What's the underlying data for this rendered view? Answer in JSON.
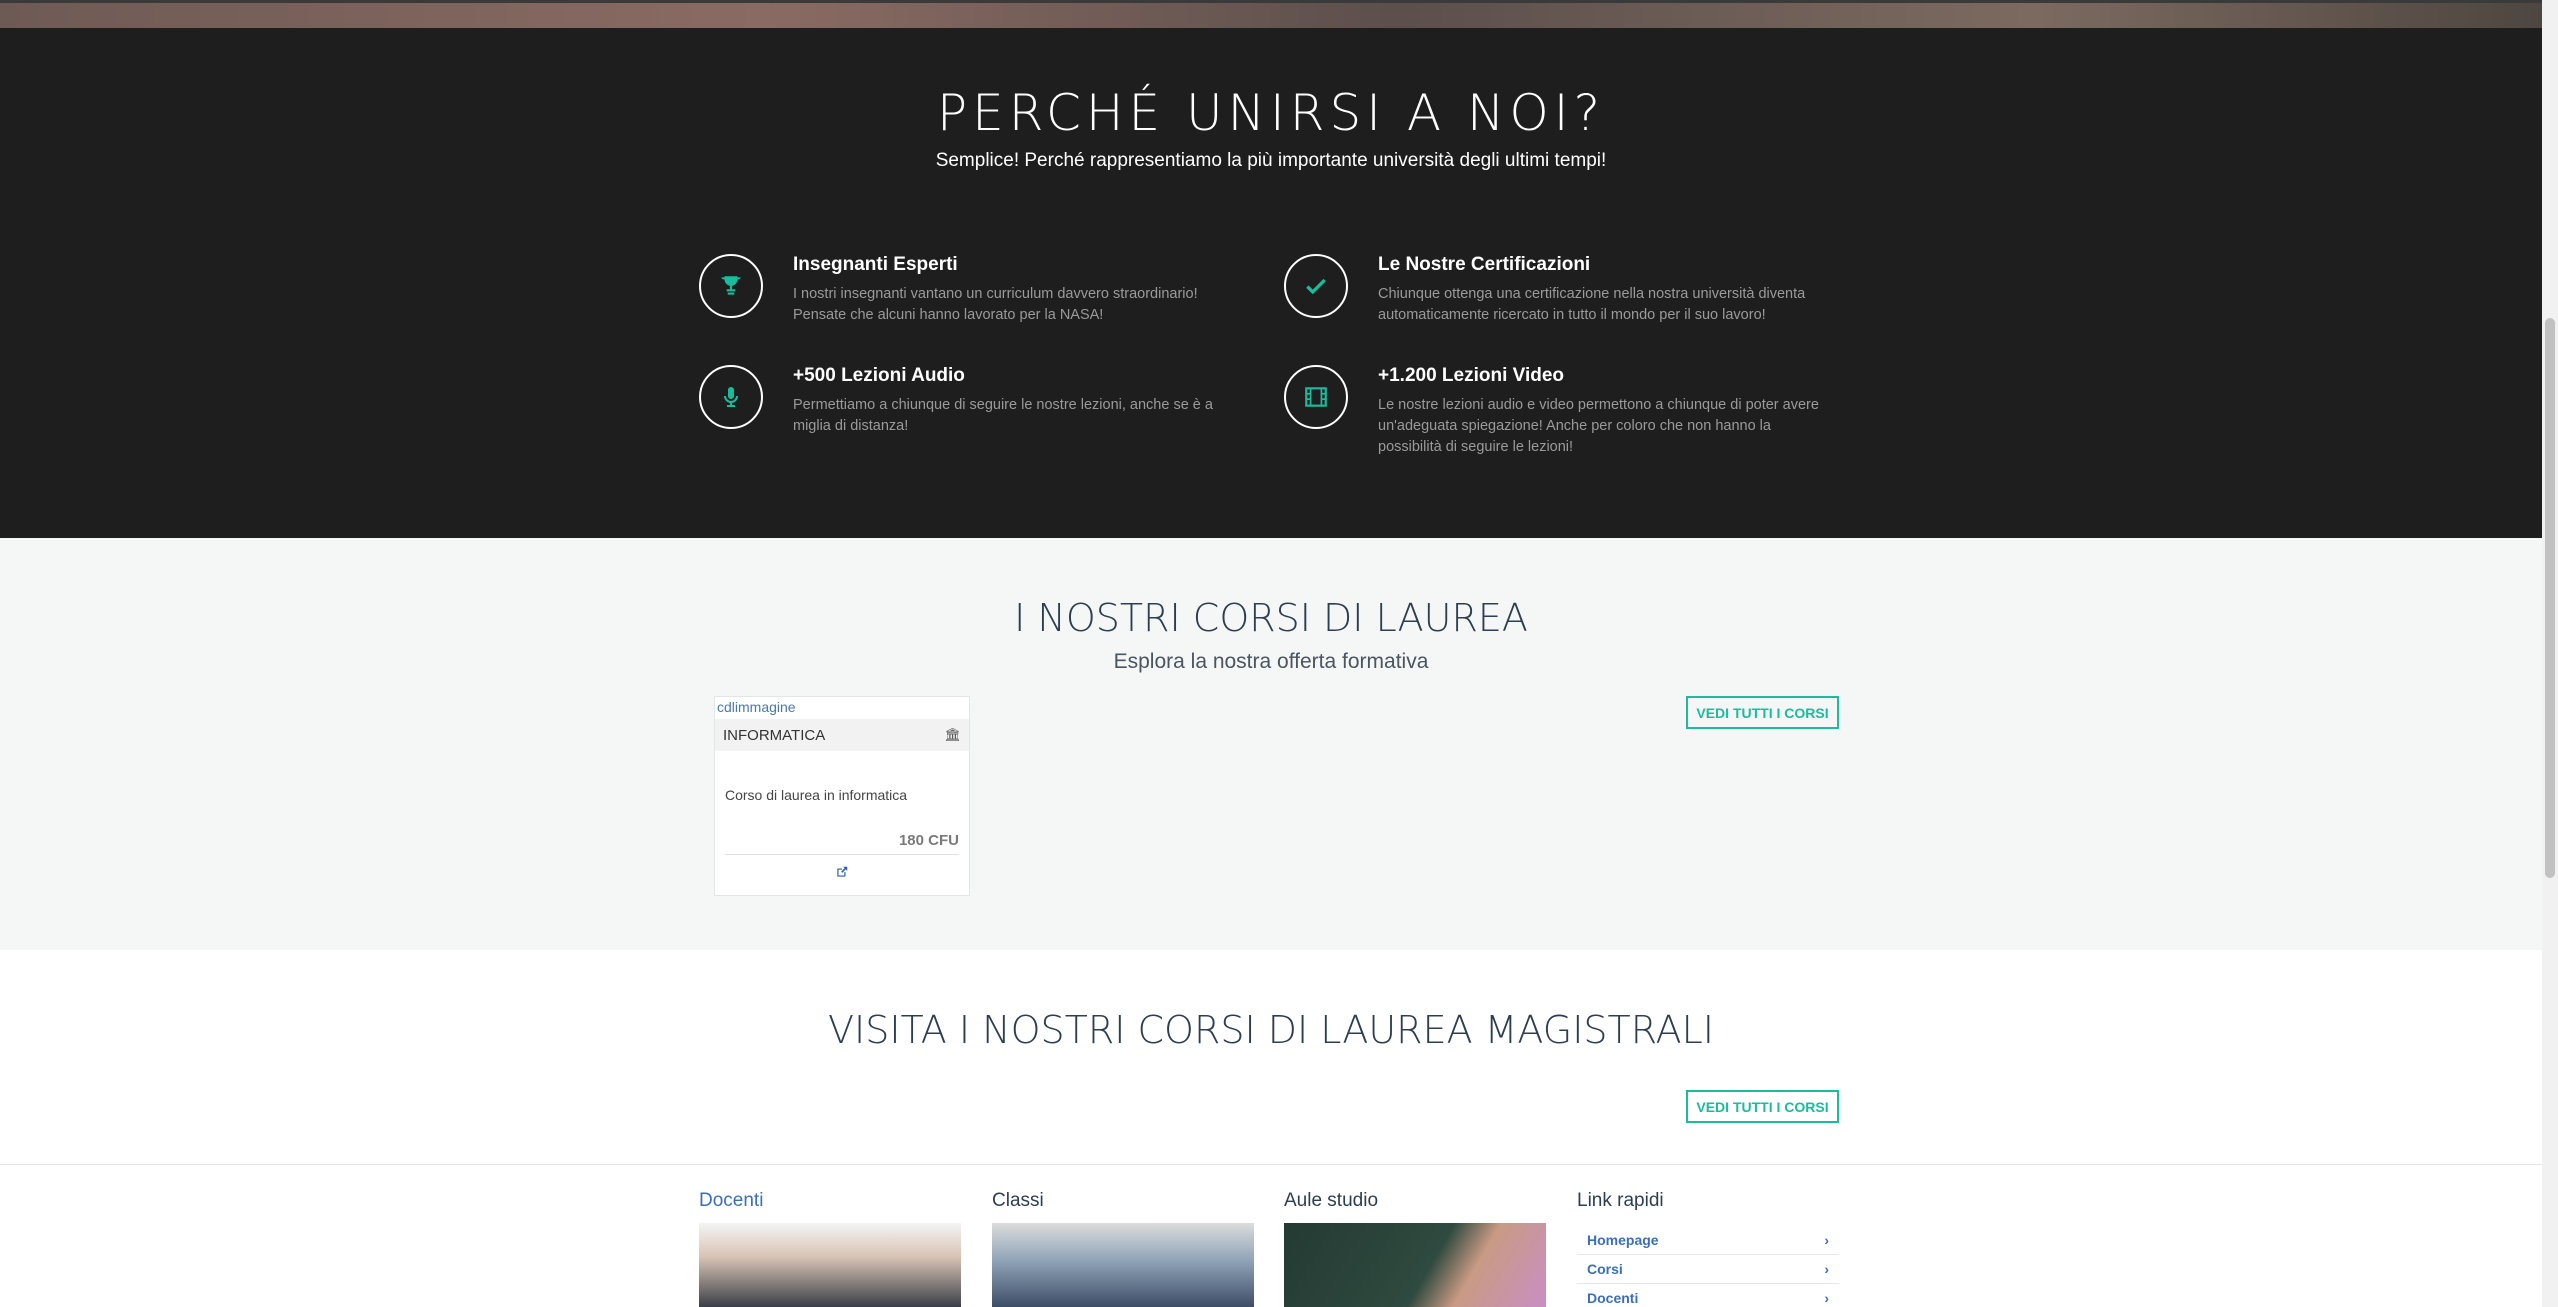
{
  "why": {
    "title": "PERCHÉ UNIRSI A NOI?",
    "subtitle": "Semplice! Perché rappresentiamo la più importante università degli ultimi tempi!",
    "features": [
      {
        "icon": "trophy-icon",
        "title": "Insegnanti Esperti",
        "text": "I nostri insegnanti vantano un curriculum davvero straordinario! Pensate che alcuni hanno lavorato per la NASA!"
      },
      {
        "icon": "check-icon",
        "title": "Le Nostre Certificazioni",
        "text": "Chiunque ottenga una certificazione nella nostra università diventa automaticamente ricercato in tutto il mondo per il suo lavoro!"
      },
      {
        "icon": "microphone-icon",
        "title": "+500 Lezioni Audio",
        "text": "Permettiamo a chiunque di seguire le nostre lezioni, anche se è a miglia di distanza!"
      },
      {
        "icon": "film-icon",
        "title": "+1.200 Lezioni Video",
        "text": "Le nostre lezioni audio e video permettono a chiunque di poter avere un'adeguata spiegazione! Anche per coloro che non hanno la possibilità di seguire le lezioni!"
      }
    ],
    "accent_color": "#1abc9c"
  },
  "courses": {
    "title": "I NOSTRI CORSI DI LAUREA",
    "subtitle": "Esplora la nostra offerta formativa",
    "view_all": "VEDI TUTTI I CORSI",
    "card": {
      "img_alt": "cdlimmagine",
      "name": "INFORMATICA",
      "description": "Corso di laurea in informatica",
      "cfu": "180 CFU"
    }
  },
  "masters": {
    "title": "VISITA I NOSTRI CORSI DI LAUREA MAGISTRALI",
    "view_all": "VEDI TUTTI I CORSI"
  },
  "footer": {
    "columns": [
      {
        "title": "Docenti"
      },
      {
        "title": "Classi"
      },
      {
        "title": "Aule studio"
      },
      {
        "title": "Link rapidi"
      }
    ],
    "quick_links": [
      "Homepage",
      "Corsi",
      "Docenti"
    ]
  }
}
